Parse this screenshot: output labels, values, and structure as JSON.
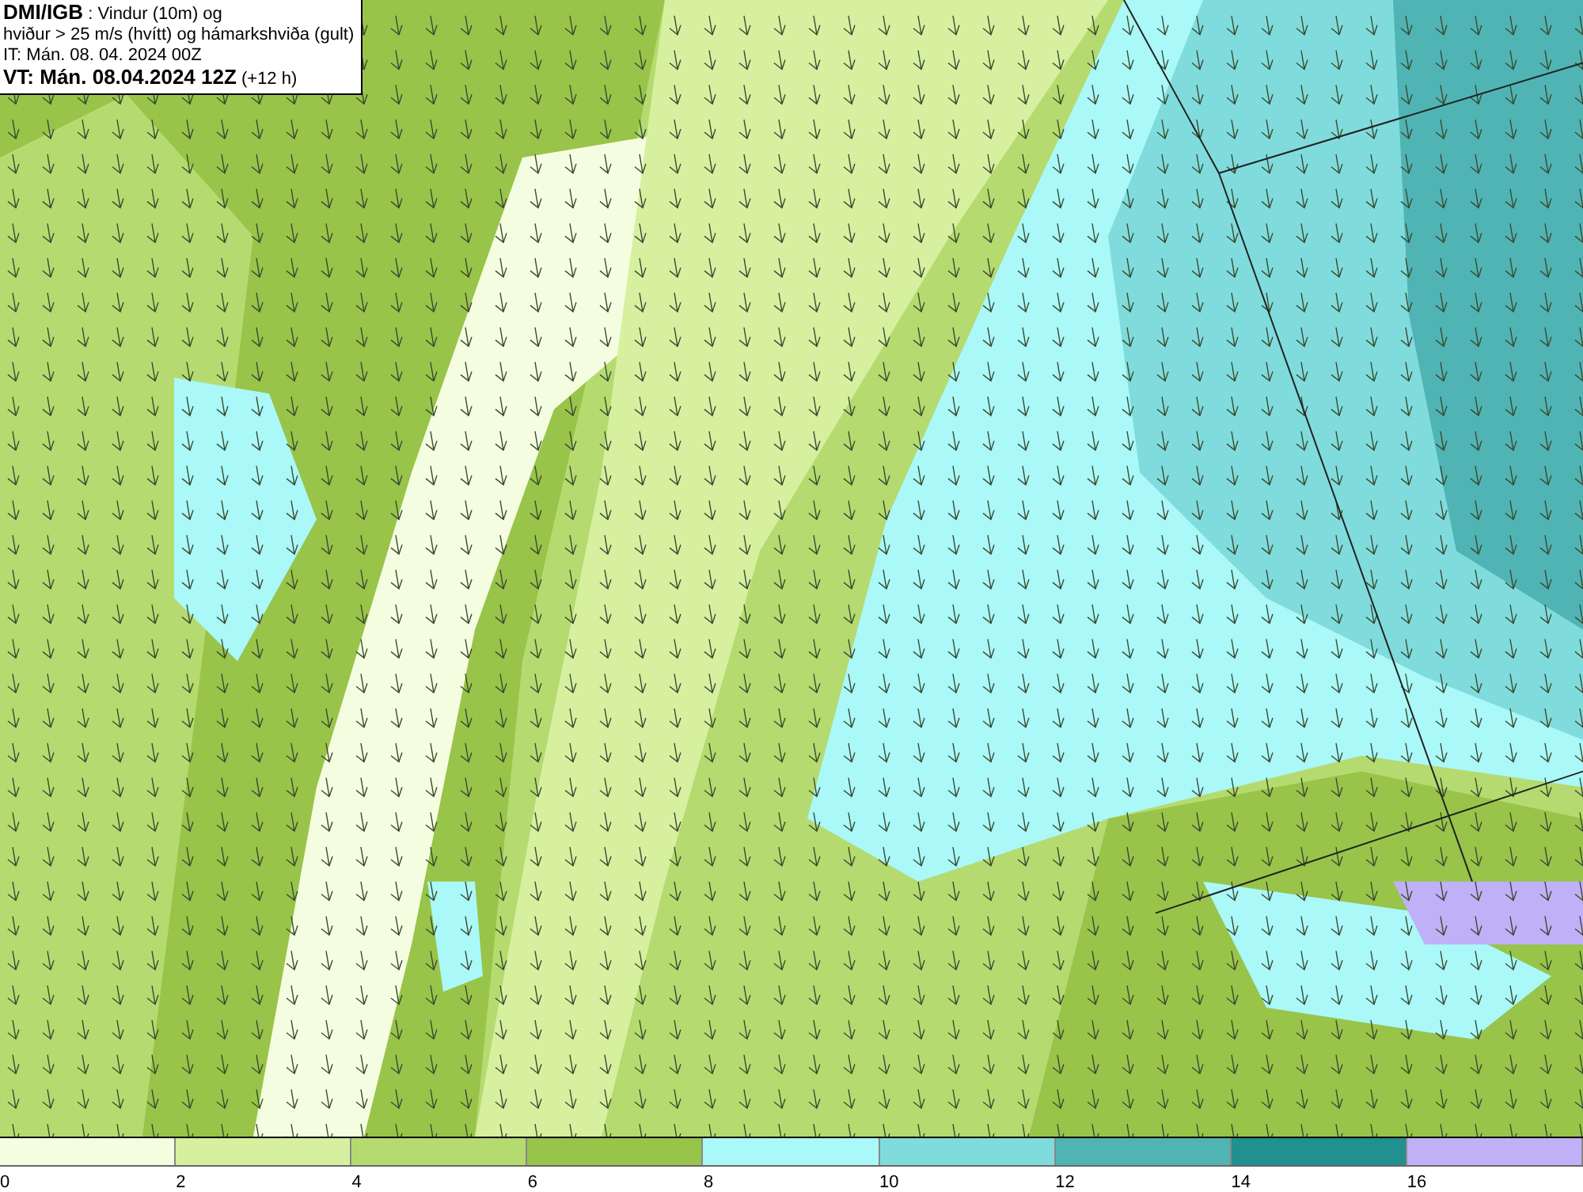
{
  "header": {
    "lines": [
      "**DMI/IGB** : Vindur (10m) og",
      "hviður > 25 m/s (hvítt) og hámarkshviða (gult)",
      "IT: Mán. 08. 04. 2024 00Z",
      "**VT: Mán. 08.04.2024 12Z** (+12 h)"
    ]
  },
  "legend": {
    "bins": [
      {
        "color": "#f5fde0",
        "label": "0"
      },
      {
        "color": "#d6f0a0",
        "label": "2"
      },
      {
        "color": "#b5db70",
        "label": "4"
      },
      {
        "color": "#98c44a",
        "label": "6"
      },
      {
        "color": "#aaf8f8",
        "label": "8"
      },
      {
        "color": "#80dcdc",
        "label": "10"
      },
      {
        "color": "#50b4b4",
        "label": "12"
      },
      {
        "color": "#209090",
        "label": "14"
      },
      {
        "color": "#c0b0f8",
        "label": "16"
      }
    ]
  }
}
